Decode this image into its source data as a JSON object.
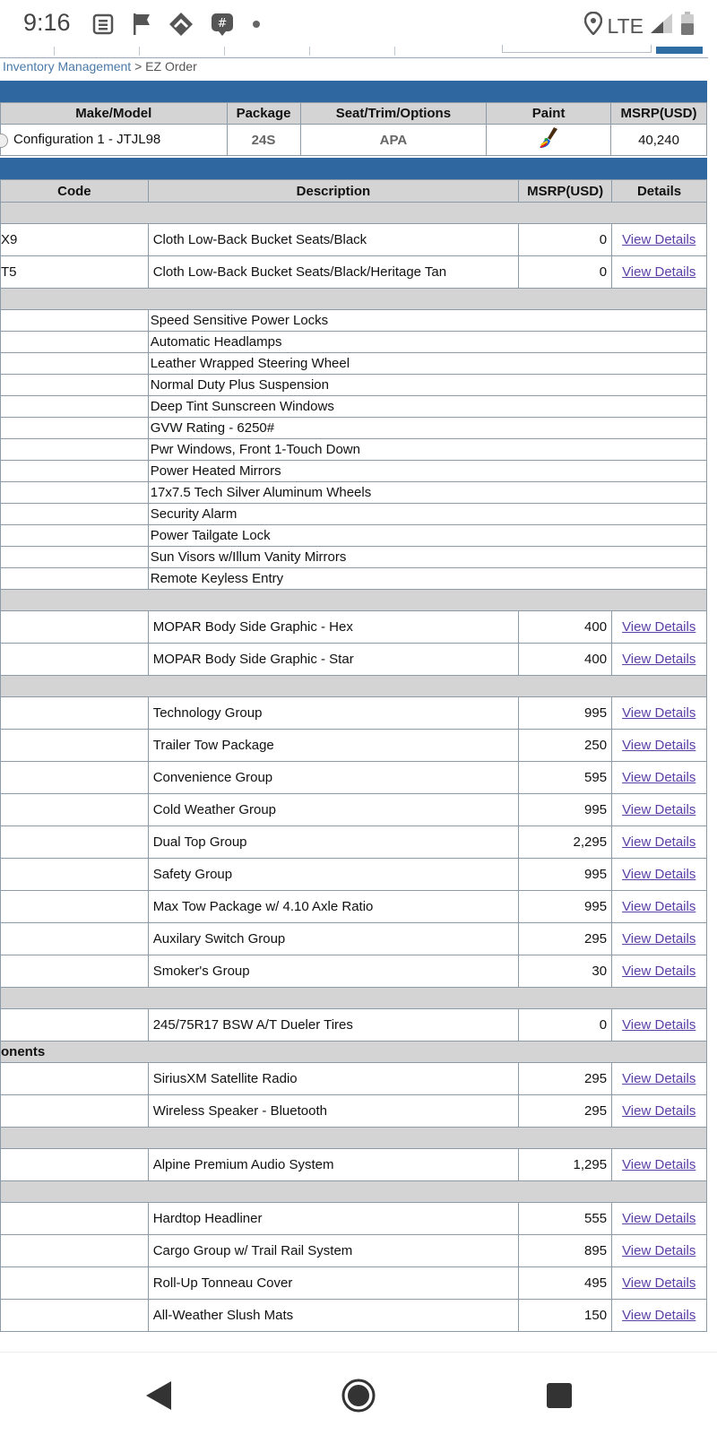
{
  "status_bar": {
    "time": "9:16",
    "network": "LTE",
    "icons": [
      "news-icon",
      "flag-icon",
      "app-icon",
      "chat-icon",
      "dot-icon",
      "location-icon",
      "signal-icon",
      "battery-icon"
    ]
  },
  "breadcrumb": {
    "parent": "Inventory Management",
    "separator": " > ",
    "current": "EZ Order"
  },
  "config_table": {
    "headers": {
      "make_model": "Make/Model",
      "package": "Package",
      "seat_trim": "Seat/Trim/Options",
      "paint": "Paint",
      "msrp": "MSRP(USD)"
    },
    "row": {
      "make_model": "Configuration 1  -  JTJL98",
      "package": "24S",
      "seat_trim": "APA",
      "paint_icon": "paint-brush-icon",
      "msrp": "40,240"
    }
  },
  "options_table": {
    "headers": {
      "code": "Code",
      "description": "Description",
      "msrp": "MSRP(USD)",
      "details": "Details"
    },
    "details_link_label": "View Details",
    "rows": [
      {
        "type": "section",
        "label": ""
      },
      {
        "type": "item",
        "code": "X9",
        "description": "Cloth Low-Back Bucket Seats/Black",
        "msrp": "0"
      },
      {
        "type": "item",
        "code": "T5",
        "description": "Cloth Low-Back Bucket Seats/Black/Heritage Tan",
        "msrp": "0"
      },
      {
        "type": "section",
        "label": ""
      },
      {
        "type": "std",
        "description": "Speed Sensitive Power Locks"
      },
      {
        "type": "std",
        "description": "Automatic Headlamps"
      },
      {
        "type": "std",
        "description": "Leather Wrapped Steering Wheel"
      },
      {
        "type": "std",
        "description": "Normal Duty Plus Suspension"
      },
      {
        "type": "std",
        "description": "Deep Tint Sunscreen Windows"
      },
      {
        "type": "std",
        "description": "GVW Rating - 6250#"
      },
      {
        "type": "std",
        "description": "Pwr Windows, Front 1-Touch Down"
      },
      {
        "type": "std",
        "description": "Power Heated Mirrors"
      },
      {
        "type": "std",
        "description": "17x7.5 Tech Silver Aluminum Wheels"
      },
      {
        "type": "std",
        "description": "Security Alarm"
      },
      {
        "type": "std",
        "description": "Power Tailgate Lock"
      },
      {
        "type": "std",
        "description": "Sun Visors w/Illum Vanity Mirrors"
      },
      {
        "type": "std",
        "description": "Remote Keyless Entry"
      },
      {
        "type": "section",
        "label": ""
      },
      {
        "type": "item",
        "code": "",
        "description": "MOPAR Body Side Graphic - Hex",
        "msrp": "400"
      },
      {
        "type": "item",
        "code": "",
        "description": "MOPAR Body Side Graphic - Star",
        "msrp": "400"
      },
      {
        "type": "section",
        "label": ""
      },
      {
        "type": "item",
        "code": "",
        "description": "Technology Group",
        "msrp": "995"
      },
      {
        "type": "item",
        "code": "",
        "description": "Trailer Tow Package",
        "msrp": "250"
      },
      {
        "type": "item",
        "code": "",
        "description": "Convenience Group",
        "msrp": "595"
      },
      {
        "type": "item",
        "code": "",
        "description": "Cold Weather Group",
        "msrp": "995"
      },
      {
        "type": "item",
        "code": "",
        "description": "Dual Top Group",
        "msrp": "2,295"
      },
      {
        "type": "item",
        "code": "",
        "description": "Safety Group",
        "msrp": "995"
      },
      {
        "type": "item",
        "code": "",
        "description": "Max Tow Package w/ 4.10 Axle Ratio",
        "msrp": "995"
      },
      {
        "type": "item",
        "code": "",
        "description": "Auxilary Switch Group",
        "msrp": "295"
      },
      {
        "type": "item",
        "code": "",
        "description": "Smoker's Group",
        "msrp": "30"
      },
      {
        "type": "section",
        "label": ""
      },
      {
        "type": "item",
        "code": "",
        "description": "245/75R17 BSW A/T Dueler Tires",
        "msrp": "0"
      },
      {
        "type": "section",
        "label": "onents"
      },
      {
        "type": "item",
        "code": "",
        "description": "SiriusXM Satellite Radio",
        "msrp": "295"
      },
      {
        "type": "item",
        "code": "",
        "description": "Wireless Speaker - Bluetooth",
        "msrp": "295"
      },
      {
        "type": "section",
        "label": ""
      },
      {
        "type": "item",
        "code": "",
        "description": "Alpine Premium Audio System",
        "msrp": "1,295"
      },
      {
        "type": "section",
        "label": ""
      },
      {
        "type": "item",
        "code": "",
        "description": "Hardtop Headliner",
        "msrp": "555"
      },
      {
        "type": "item",
        "code": "",
        "description": "Cargo Group w/ Trail Rail System",
        "msrp": "895"
      },
      {
        "type": "item",
        "code": "",
        "description": "Roll-Up Tonneau Cover",
        "msrp": "495"
      },
      {
        "type": "item",
        "code": "",
        "description": "All-Weather Slush Mats",
        "msrp": "150"
      }
    ]
  },
  "colors": {
    "header_blue": "#2f67a0",
    "header_gray": "#d4d4d4",
    "border": "#8d9aa8",
    "link": "#5b3ea6"
  },
  "nav_bar": {
    "icons": [
      "back-icon",
      "home-icon",
      "recents-icon"
    ]
  }
}
